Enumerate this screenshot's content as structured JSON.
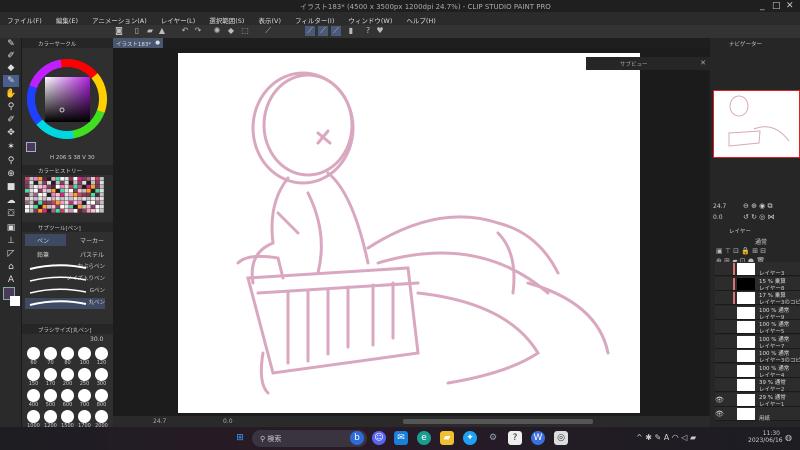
{
  "window": {
    "title": "イラスト183* (4500 x 3500px 1200dpi 24.7%) - CLIP STUDIO PAINT PRO",
    "minimize": "_",
    "maximize": "□",
    "close": "✕"
  },
  "menu": [
    "ファイル(F)",
    "編集(E)",
    "アニメーション(A)",
    "レイヤー(L)",
    "選択範囲(S)",
    "表示(V)",
    "フィルター(I)",
    "ウィンドウ(W)",
    "ヘルプ(H)"
  ],
  "document_tab": {
    "label": "イラスト183*",
    "close": "●"
  },
  "color_panel": {
    "title": "カラーサークル",
    "values": [
      "206",
      "38",
      "30"
    ],
    "main_color": "#4a3a5a",
    "sub_color": "#ffffff"
  },
  "color_history": {
    "title": "カラーヒストリー"
  },
  "subtool": {
    "title": "サブツール[ペン]",
    "groups": [
      "ペン",
      "マーカー",
      "鉛筆",
      "パステル"
    ],
    "brushes": [
      "かぶらペン",
      "ノイズ入りペン",
      "Gペン",
      "丸ペン"
    ],
    "selected_brush": "丸ペン"
  },
  "brush_size": {
    "title": "ブラシサイズ[丸ペン]",
    "value": "30.0",
    "sizes": [
      "60",
      "70",
      "80",
      "100",
      "120",
      "150",
      "170",
      "200",
      "250",
      "300",
      "400",
      "500",
      "600",
      "700",
      "800",
      "1000",
      "1200",
      "1500",
      "1700",
      "2000"
    ]
  },
  "subview": {
    "title": "サブビュー"
  },
  "navigator": {
    "title": "ナビゲーター",
    "zoom": "24.7",
    "angle": "0.0"
  },
  "layer_panel": {
    "title": "レイヤー",
    "blend_mode": "通常",
    "layers": [
      {
        "opacity": "",
        "name": "レイヤー3",
        "visible": false,
        "clip": true
      },
      {
        "opacity": "15 % 乗算",
        "name": "レイヤー8",
        "visible": false,
        "clip": true
      },
      {
        "opacity": "17 % 乗算",
        "name": "レイヤー3のコピー",
        "visible": false,
        "clip": true
      },
      {
        "opacity": "100 % 通常",
        "name": "レイヤー9",
        "visible": false
      },
      {
        "opacity": "100 % 通常",
        "name": "レイヤー5",
        "visible": false
      },
      {
        "opacity": "100 % 通常",
        "name": "レイヤー7",
        "visible": false
      },
      {
        "opacity": "100 % 通常",
        "name": "レイヤー3のコピー",
        "visible": false
      },
      {
        "opacity": "100 % 通常",
        "name": "レイヤー4",
        "visible": false
      },
      {
        "opacity": "39 % 通常",
        "name": "レイヤー2",
        "visible": false
      },
      {
        "opacity": "29 % 通常",
        "name": "レイヤー1",
        "visible": true
      },
      {
        "opacity": "",
        "name": "用紙",
        "visible": true
      }
    ]
  },
  "statusbar": {
    "zoom": "24.7",
    "angle": "0.0"
  },
  "taskbar": {
    "search": "検索",
    "time": "11:30",
    "date": "2023/06/16"
  },
  "colors": {
    "sketch": "#d9a8c0",
    "accent": "#4a5f8c"
  }
}
